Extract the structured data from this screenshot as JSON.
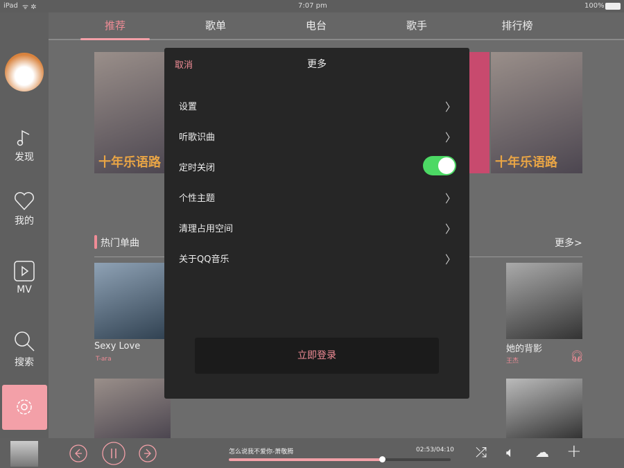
{
  "status": {
    "device": "iPad",
    "time": "7:07 pm",
    "battery": "100%"
  },
  "tabs": [
    "推荐",
    "歌单",
    "电台",
    "歌手",
    "排行榜"
  ],
  "sidebar": [
    {
      "label": "发现",
      "icon": "music-note-icon"
    },
    {
      "label": "我的",
      "icon": "heart-icon"
    },
    {
      "label": "MV",
      "icon": "play-box-icon"
    },
    {
      "label": "搜索",
      "icon": "search-icon"
    },
    {
      "label": "",
      "icon": "gear-icon"
    }
  ],
  "banner_text": "十年乐语路",
  "section": {
    "title": "热门单曲",
    "more": "更多>"
  },
  "songs": [
    {
      "title": "Sexy Love",
      "artist": "T-ara"
    },
    {
      "title": "她的背影",
      "artist": "王杰"
    }
  ],
  "modal": {
    "cancel": "取消",
    "title": "更多",
    "items": [
      "设置",
      "听歌识曲",
      "定时关闭",
      "个性主题",
      "清理占用空间",
      "关于QQ音乐"
    ],
    "timer_on": true,
    "login": "立即登录"
  },
  "player": {
    "track": "怎么说我不爱你-萧敬腾",
    "time": "02:53/04:10",
    "progress": 0.69
  },
  "colors": {
    "accent": "#f08c96",
    "toggle": "#4cd964"
  }
}
